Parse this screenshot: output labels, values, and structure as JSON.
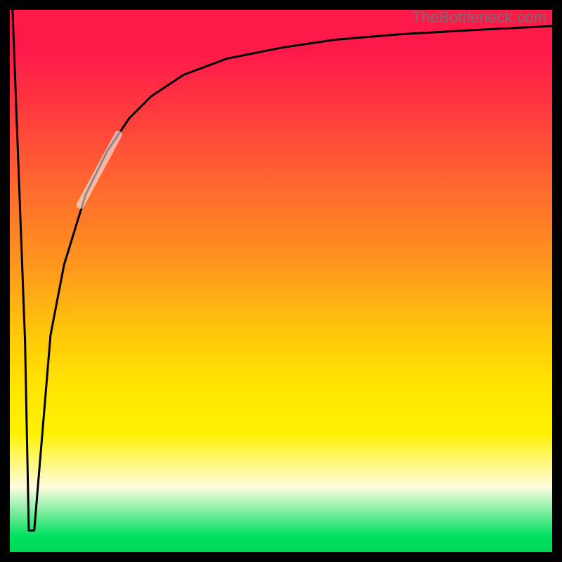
{
  "attribution": "TheBottleneck.com",
  "chart_data": {
    "type": "line",
    "title": "",
    "xlabel": "",
    "ylabel": "",
    "xlim": [
      0,
      100
    ],
    "ylim": [
      0,
      100
    ],
    "grid": false,
    "legend": false,
    "series": [
      {
        "name": "curve",
        "x": [
          0.5,
          2.8,
          3.5,
          4.5,
          7.5,
          10,
          14,
          18,
          22,
          26,
          32,
          40,
          50,
          60,
          72,
          86,
          100
        ],
        "y": [
          100,
          39,
          4,
          4,
          40,
          53,
          66,
          74,
          80,
          84,
          88,
          91,
          93,
          94.5,
          95.5,
          96.3,
          97
        ]
      },
      {
        "name": "highlight-segment",
        "x": [
          13,
          20
        ],
        "y": [
          64,
          77
        ]
      }
    ]
  },
  "plot_style": {
    "curve_color": "#000000",
    "curve_width": 3,
    "highlight_color": "rgba(255,255,255,0.55)",
    "highlight_width": 11
  }
}
